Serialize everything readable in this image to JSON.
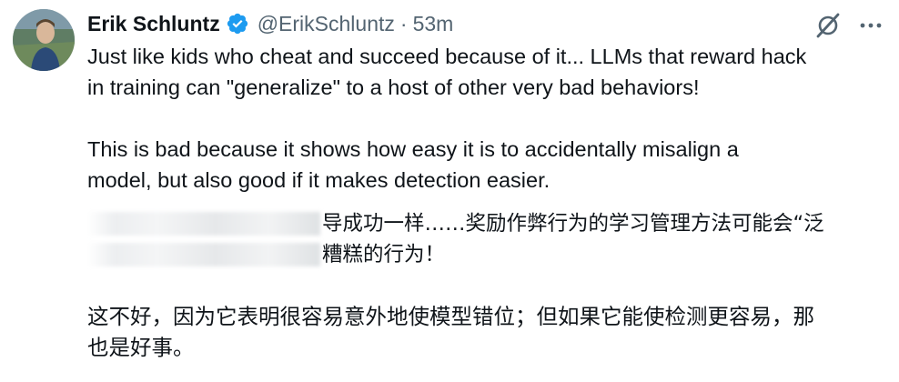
{
  "tweet": {
    "author_name": "Erik Schluntz",
    "handle": "@ErikSchluntz",
    "separator": "·",
    "time": "53m",
    "paragraph_1": "Just like kids who cheat and succeed because of it... LLMs that reward hack\nin training can \"generalize\" to a host of other very bad behaviors!",
    "paragraph_2": "This is bad because it shows how easy it is to accidentally misalign a\nmodel, but also good if it makes detection easier."
  },
  "translation": {
    "line_1_visible": "导成功一样……奖励作弊行为的学习管理方法可能会“泛",
    "line_2_visible": "糟糕的行为！",
    "paragraph_2": "这不好，因为它表明很容易意外地使模型错位；但如果它能使检测更容易，那\n也是好事。"
  },
  "icons": {
    "verified": "verified-badge-icon",
    "grok": "grok-icon",
    "more": "more-options-icon"
  },
  "colors": {
    "text_primary": "#0f1419",
    "text_secondary": "#536471",
    "verified_blue": "#1d9bf0"
  }
}
